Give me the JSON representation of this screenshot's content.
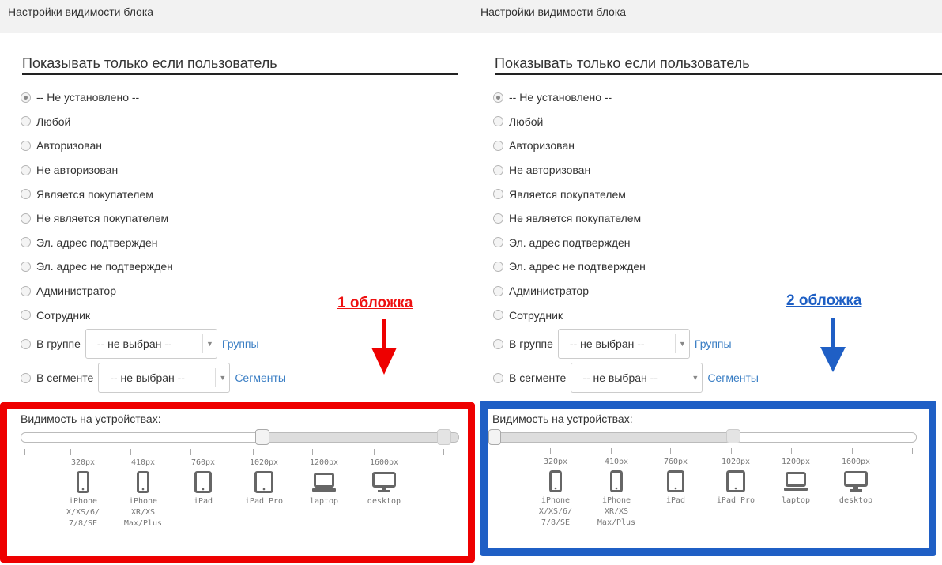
{
  "header": {
    "title": "Настройки видимости блока"
  },
  "section_title": "Показывать только если пользователь",
  "options": [
    {
      "label": "-- Не установлено --",
      "checked": true
    },
    {
      "label": "Любой",
      "checked": false
    },
    {
      "label": "Авторизован",
      "checked": false
    },
    {
      "label": "Не авторизован",
      "checked": false
    },
    {
      "label": "Является покупателем",
      "checked": false
    },
    {
      "label": "Не является покупателем",
      "checked": false
    },
    {
      "label": "Эл. адрес подтвержден",
      "checked": false
    },
    {
      "label": "Эл. адрес не подтвержден",
      "checked": false
    },
    {
      "label": "Администратор",
      "checked": false
    },
    {
      "label": "Сотрудник",
      "checked": false
    }
  ],
  "group_option": {
    "label": "В группе",
    "select_value": "-- не выбран --",
    "link": "Группы"
  },
  "segment_option": {
    "label": "В сегменте",
    "select_value": "-- не выбран --",
    "link": "Сегменты"
  },
  "device_visibility_title": "Видимость на устройствах:",
  "devices": [
    {
      "px": "320px",
      "name": "iPhone X/XS/6/ 7/8/SE",
      "icon": "phone-icon"
    },
    {
      "px": "410px",
      "name": "iPhone XR/XS Max/Plus",
      "icon": "phone-icon"
    },
    {
      "px": "760px",
      "name": "iPad",
      "icon": "tablet-icon"
    },
    {
      "px": "1020px",
      "name": "iPad Pro",
      "icon": "tablet-icon"
    },
    {
      "px": "1200px",
      "name": "laptop",
      "icon": "laptop-icon"
    },
    {
      "px": "1600px",
      "name": "desktop",
      "icon": "desktop-icon"
    }
  ],
  "annotations": {
    "left": "1 обложка",
    "right": "2 обложка"
  },
  "colors": {
    "red": "#e00000",
    "blue": "#1f5fc5",
    "link": "#3a7ec4"
  },
  "slider_state": {
    "left": {
      "min": "1020px",
      "max": "1600px+"
    },
    "right": {
      "min": "0",
      "max": "1020px"
    }
  }
}
